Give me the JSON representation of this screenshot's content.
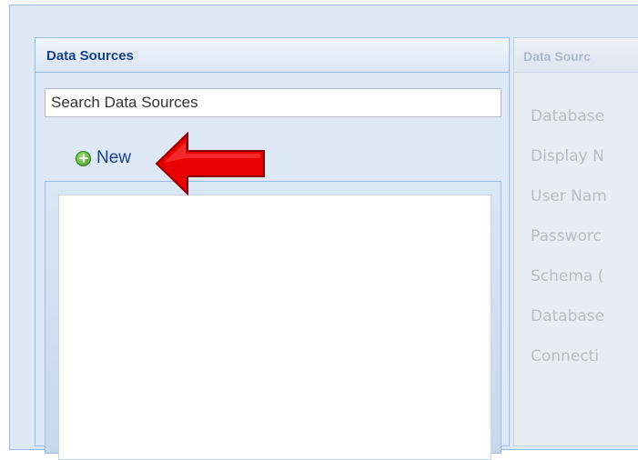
{
  "left_panel": {
    "title": "Data Sources",
    "search_placeholder": "Search Data Sources",
    "new_button_label": "New"
  },
  "right_panel": {
    "title": "Data Sourc",
    "fields": [
      "Database",
      "Display N",
      "User Nam",
      "Passworc",
      "Schema (",
      "Database",
      "Connecti"
    ]
  },
  "annotation": {
    "arrow_color": "#e60000",
    "arrow_icon": "red-arrow-left-icon"
  }
}
